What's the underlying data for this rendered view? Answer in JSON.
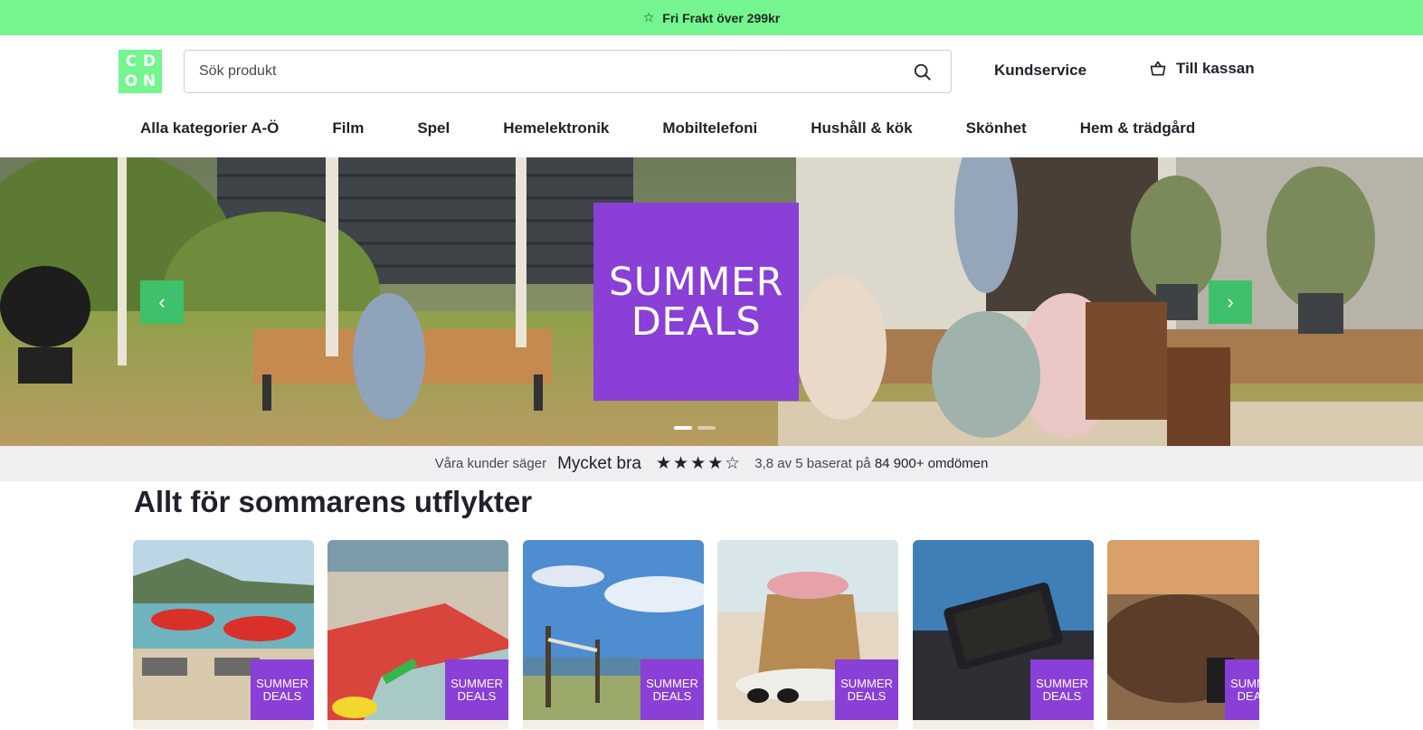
{
  "promo": {
    "icon": "star-icon",
    "text": "Fri Frakt över 299kr"
  },
  "header": {
    "logo_letters": [
      "C",
      "D",
      "O",
      "N"
    ],
    "search": {
      "placeholder": "Sök produkt",
      "value": ""
    },
    "customer_service": "Kundservice",
    "checkout": "Till kassan"
  },
  "nav": {
    "items": [
      "Alla kategorier A-Ö",
      "Film",
      "Spel",
      "Hemelektronik",
      "Mobiltelefoni",
      "Hushåll & kök",
      "Skönhet",
      "Hem & trädgård"
    ]
  },
  "hero": {
    "badge_line1": "SUMMER",
    "badge_line2": "DEALS",
    "prev_label": "‹",
    "next_label": "›",
    "active_slide": 1,
    "slide_count": 2
  },
  "rating": {
    "prefix": "Våra kunder säger",
    "verdict": "Mycket bra",
    "stars_filled": 4,
    "stars_total": 5,
    "score_text": "3,8 av 5 baserat på",
    "reviews_count": "84 900+ omdömen"
  },
  "section": {
    "title": "Allt för sommarens utflykter",
    "cards": [
      {
        "tag_line1": "SUMMER",
        "tag_line2": "DEALS"
      },
      {
        "tag_line1": "SUMMER",
        "tag_line2": "DEALS"
      },
      {
        "tag_line1": "SUMMER",
        "tag_line2": "DEALS"
      },
      {
        "tag_line1": "SUMMER",
        "tag_line2": "DEALS"
      },
      {
        "tag_line1": "SUMMER",
        "tag_line2": "DEALS"
      },
      {
        "tag_line1": "SUMMER",
        "tag_line2": "DEALS"
      }
    ]
  },
  "colors": {
    "brand_green": "#74f58f",
    "accent_purple": "#8a3fd6",
    "arrow_green": "#3ec16a"
  }
}
